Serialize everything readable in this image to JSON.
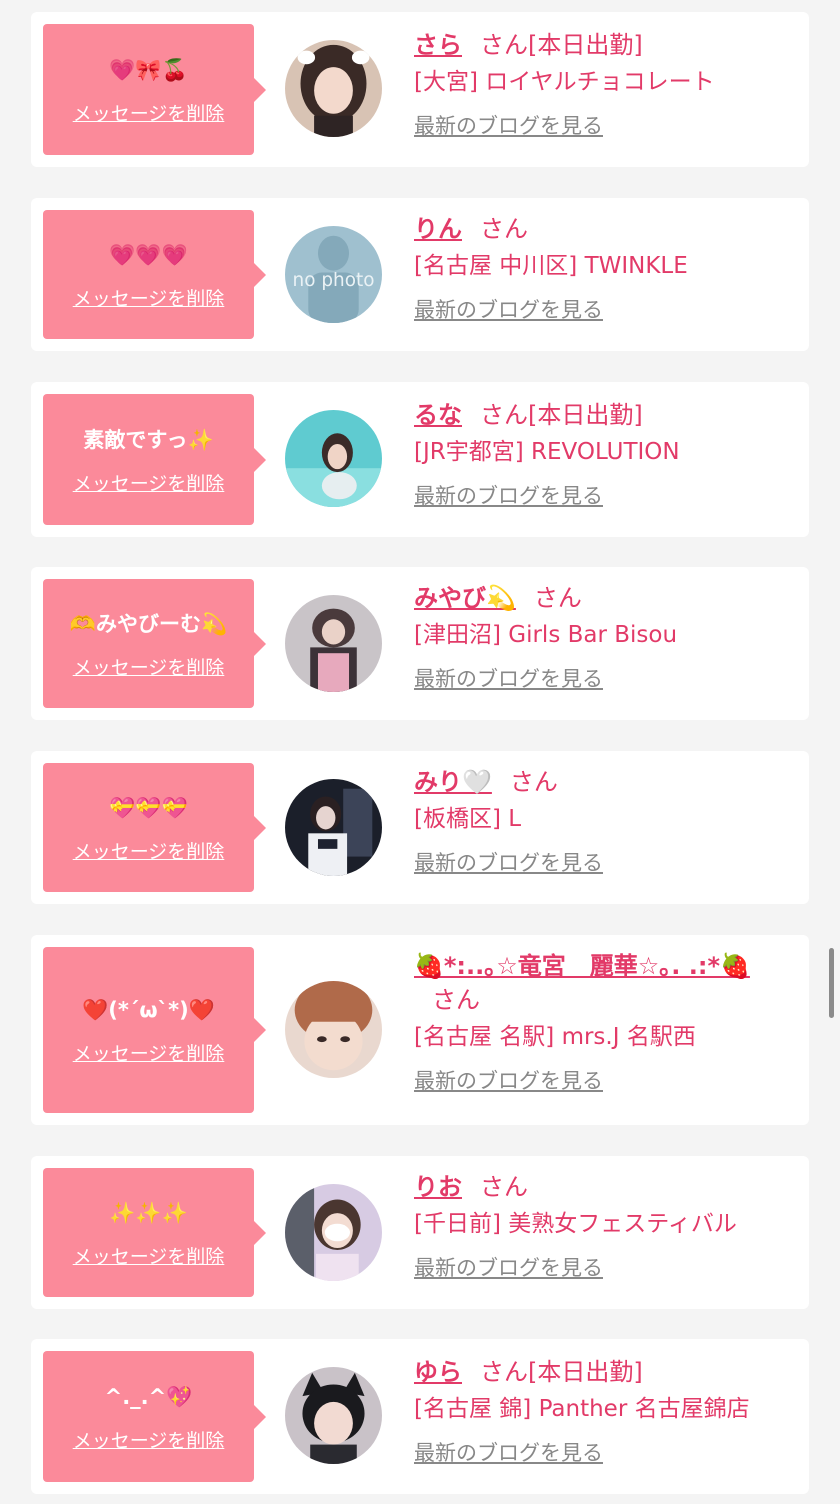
{
  "colors": {
    "accent": "#e23a68",
    "bubble": "#fb8a9a",
    "link_gray": "#888888",
    "background": "#f4f4f4"
  },
  "common": {
    "delete_label": "メッセージを削除",
    "blog_label": "最新のブログを見る",
    "san": "さん"
  },
  "cards": [
    {
      "message": "💗🎀🍒",
      "name": "さら",
      "status": "[本日出勤]",
      "shop": "[大宮] ロイヤルチョコレート",
      "avatar": "photo"
    },
    {
      "message": "💗💗💗",
      "name": "りん",
      "status": "",
      "shop": "[名古屋 中川区] TWINKLE",
      "avatar": "no photo"
    },
    {
      "message": "素敵ですっ✨",
      "name": "るな",
      "status": "[本日出勤]",
      "shop": "[JR宇都宮] REVOLUTION",
      "avatar": "photo"
    },
    {
      "message": "🫶みやびーむ💫",
      "name": "みやび💫",
      "status": "",
      "shop": "[津田沼] Girls Bar Bisou",
      "avatar": "photo"
    },
    {
      "message": "💝💝💝",
      "name": "みり🤍",
      "status": "",
      "shop": "[板橋区] L",
      "avatar": "photo"
    },
    {
      "message": "❤️(*´ω`*)❤️",
      "name": "🍓*:..｡☆竜宮　麗華☆｡. .:*🍓",
      "status": "",
      "shop": "[名古屋 名駅] mrs.J 名駅西",
      "avatar": "photo"
    },
    {
      "message": "✨✨✨",
      "name": "りお",
      "status": "",
      "shop": "[千日前] 美熟女フェスティバル",
      "avatar": "photo"
    },
    {
      "message": "^._.^💖",
      "name": "ゆら",
      "status": "[本日出勤]",
      "shop": "[名古屋 錦] Panther 名古屋錦店",
      "avatar": "photo"
    }
  ]
}
